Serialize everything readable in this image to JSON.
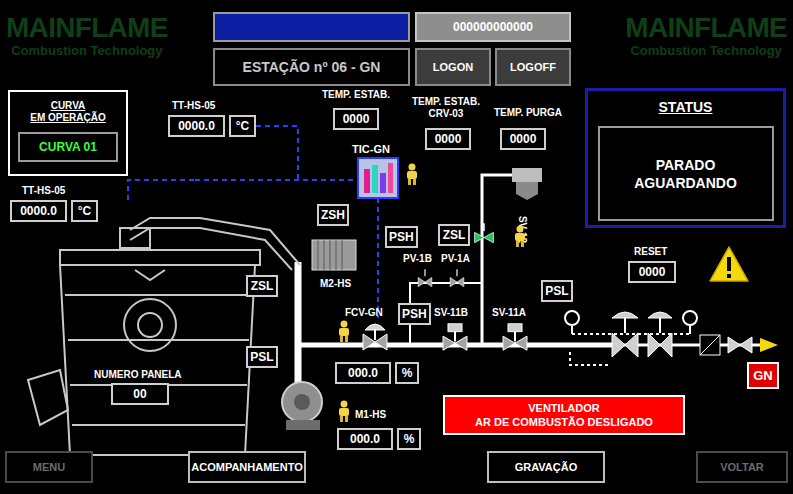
{
  "brand": {
    "name": "MAINFLAME",
    "tagline": "Combustion Technology"
  },
  "header": {
    "code": "000000000000",
    "station": "ESTAÇÃO nº 06 - GN",
    "buttons": [
      {
        "label": "LOGON"
      },
      {
        "label": "LOGOFF"
      }
    ]
  },
  "curve": {
    "title": [
      "CURVA",
      "EM OPERAÇÃO"
    ],
    "value": "CURVA 01"
  },
  "temperatures": [
    {
      "tag": "TT-HS-05",
      "value": "0000.0",
      "unit": "°C"
    },
    {
      "tag": "TT-HS-05",
      "value": "0000.0",
      "unit": "°C"
    }
  ],
  "setpoints": [
    {
      "label": [
        "TEMP. ESTAB."
      ],
      "value": "0000"
    },
    {
      "label": [
        "TEMP. ESTAB.",
        "CRV-03"
      ],
      "value": "0000"
    },
    {
      "label": [
        "TEMP. PURGA"
      ],
      "value": "0000"
    }
  ],
  "status": {
    "title": "STATUS",
    "lines": [
      "PARADO",
      "AGUARDANDO"
    ]
  },
  "reset": {
    "label": "RESET",
    "value": "0000"
  },
  "ladle": {
    "label": "NUMERO PANELA",
    "value": "00"
  },
  "controller": {
    "tag": "TIC-GN"
  },
  "switches": [
    {
      "tag": "ZSH"
    },
    {
      "tag": "PSH"
    },
    {
      "tag": "ZSL"
    },
    {
      "tag": "ZSL"
    },
    {
      "tag": "PSL"
    },
    {
      "tag": "PSH"
    },
    {
      "tag": "PSL"
    }
  ],
  "valves": [
    {
      "tag": "PV-1B",
      "open": false
    },
    {
      "tag": "PV-1A",
      "open": false
    },
    {
      "tag": "SV-12",
      "open": true
    },
    {
      "tag": "FCV-GN",
      "open": false
    },
    {
      "tag": "SV-11B",
      "open": false
    },
    {
      "tag": "SV-11A",
      "open": false
    }
  ],
  "motors": [
    {
      "tag": "M2-HS"
    }
  ],
  "outputs": [
    {
      "tag": "",
      "value": "000.0",
      "unit": "%"
    },
    {
      "tag": "M1-HS",
      "value": "000.0",
      "unit": "%"
    }
  ],
  "alarm": {
    "lines": [
      "VENTILADOR",
      "AR DE COMBUSTÃO DESLIGADO"
    ],
    "active": true
  },
  "warning": {
    "active": true
  },
  "fuel": {
    "label": "GN"
  },
  "footer": [
    {
      "label": "MENU",
      "disabled": true
    },
    {
      "label": "ACOMPANHAMENTO",
      "disabled": false
    },
    {
      "label": "GRAVAÇÃO",
      "disabled": false
    },
    {
      "label": "VOLTAR",
      "disabled": true
    }
  ]
}
